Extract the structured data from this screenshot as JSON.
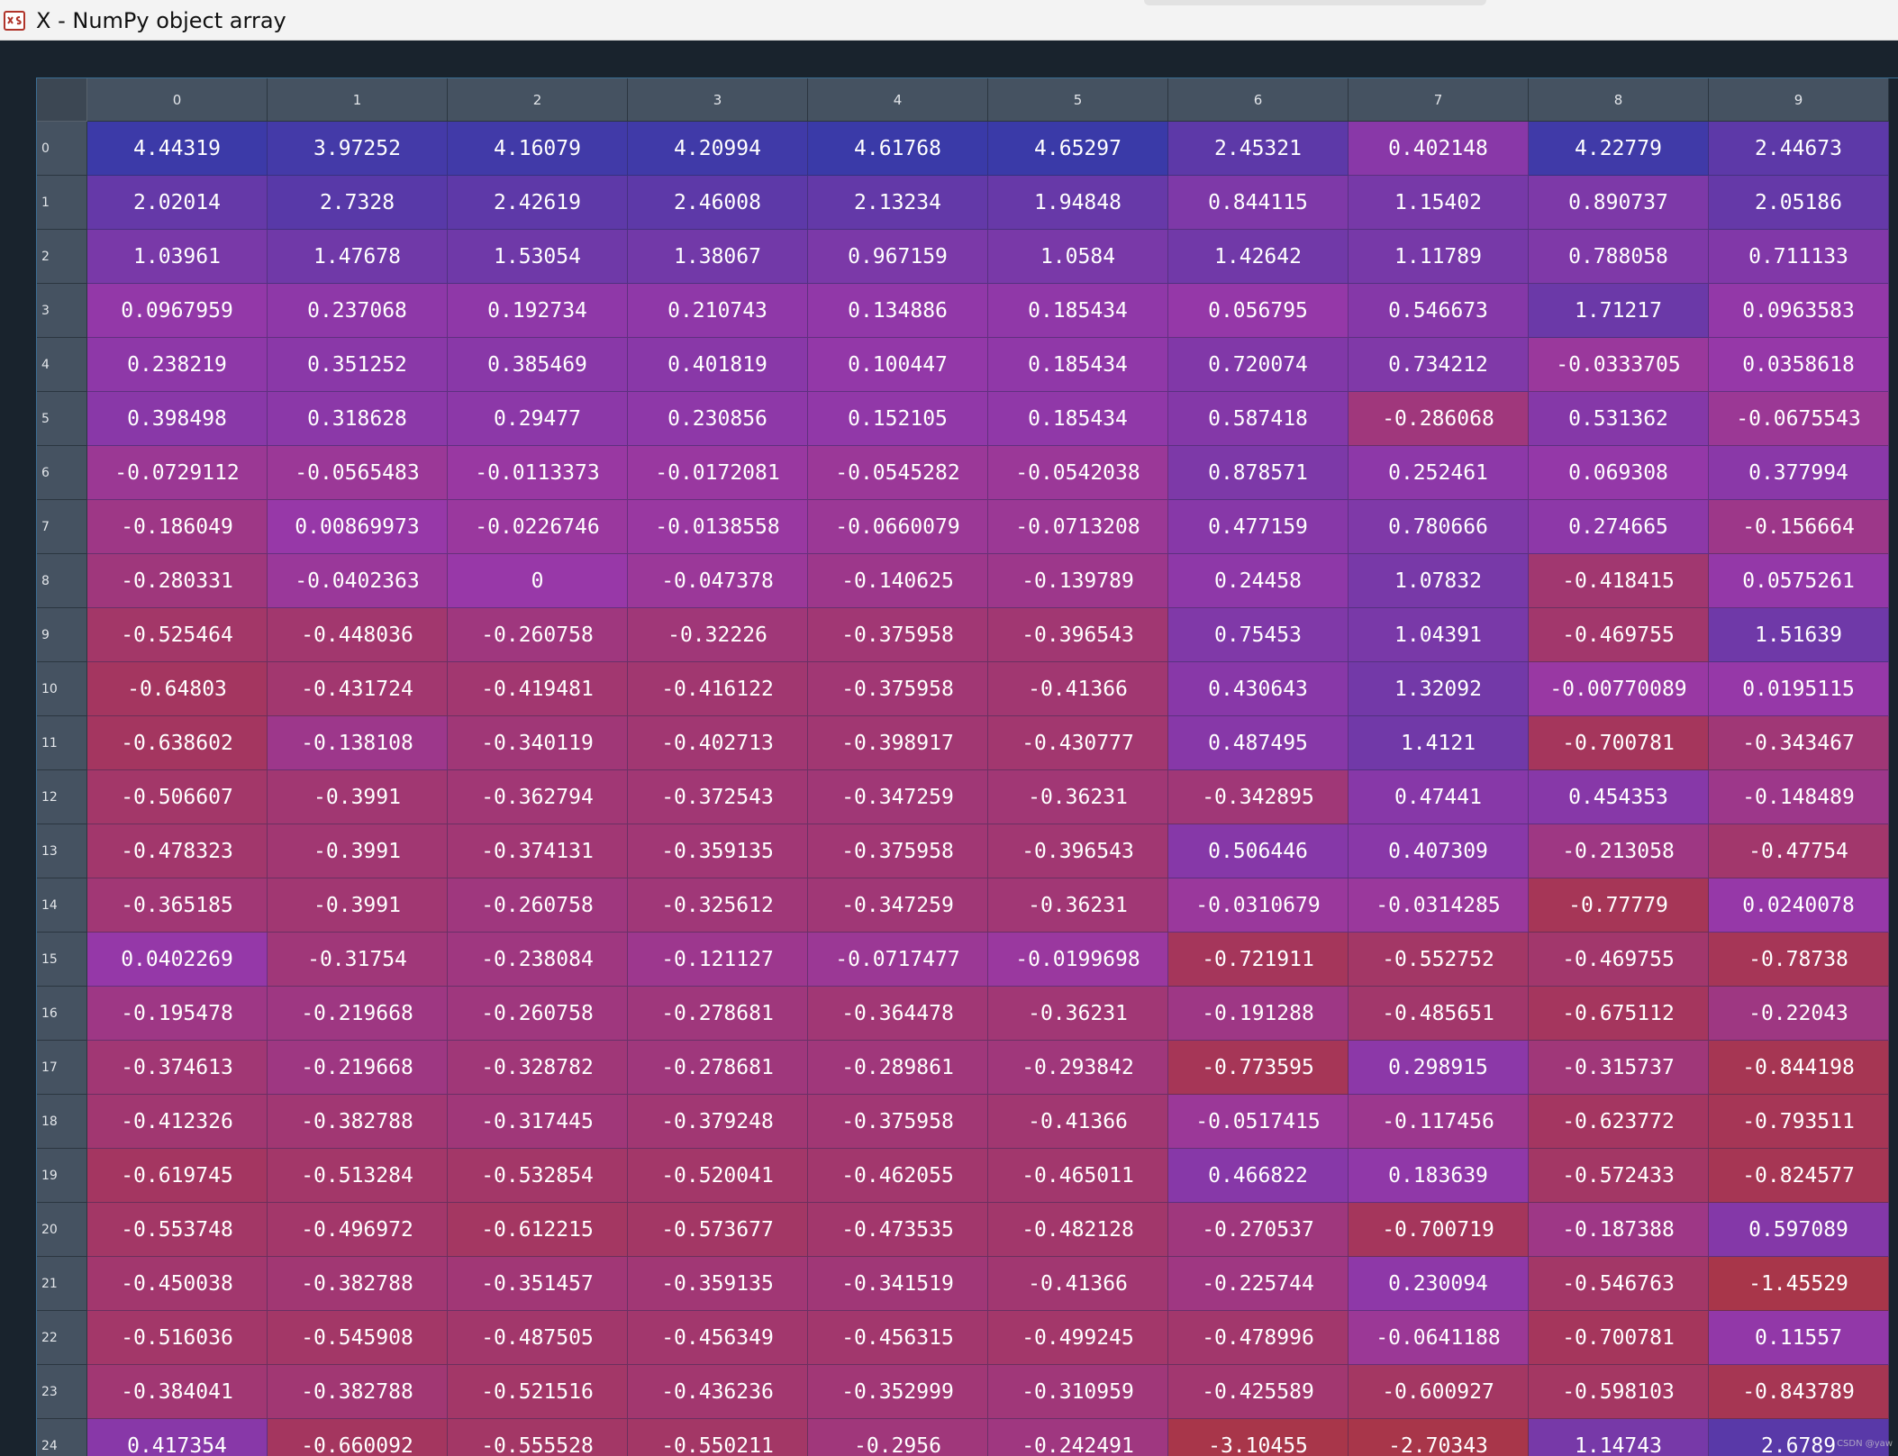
{
  "window": {
    "title": "X - NumPy object array",
    "icon": "spyder-variable-explorer-icon"
  },
  "table": {
    "columns": [
      "0",
      "1",
      "2",
      "3",
      "4",
      "5",
      "6",
      "7",
      "8",
      "9"
    ],
    "rows": [
      {
        "label": "0",
        "values": [
          "4.44319",
          "3.97252",
          "4.16079",
          "4.20994",
          "4.61768",
          "4.65297",
          "2.45321",
          "0.402148",
          "4.22779",
          "2.44673"
        ]
      },
      {
        "label": "1",
        "values": [
          "2.02014",
          "2.7328",
          "2.42619",
          "2.46008",
          "2.13234",
          "1.94848",
          "0.844115",
          "1.15402",
          "0.890737",
          "2.05186"
        ]
      },
      {
        "label": "2",
        "values": [
          "1.03961",
          "1.47678",
          "1.53054",
          "1.38067",
          "0.967159",
          "1.0584",
          "1.42642",
          "1.11789",
          "0.788058",
          "0.711133"
        ]
      },
      {
        "label": "3",
        "values": [
          "0.0967959",
          "0.237068",
          "0.192734",
          "0.210743",
          "0.134886",
          "0.185434",
          "0.056795",
          "0.546673",
          "1.71217",
          "0.0963583"
        ]
      },
      {
        "label": "4",
        "values": [
          "0.238219",
          "0.351252",
          "0.385469",
          "0.401819",
          "0.100447",
          "0.185434",
          "0.720074",
          "0.734212",
          "-0.0333705",
          "0.0358618"
        ]
      },
      {
        "label": "5",
        "values": [
          "0.398498",
          "0.318628",
          "0.29477",
          "0.230856",
          "0.152105",
          "0.185434",
          "0.587418",
          "-0.286068",
          "0.531362",
          "-0.0675543"
        ]
      },
      {
        "label": "6",
        "values": [
          "-0.0729112",
          "-0.0565483",
          "-0.0113373",
          "-0.0172081",
          "-0.0545282",
          "-0.0542038",
          "0.878571",
          "0.252461",
          "0.069308",
          "0.377994"
        ]
      },
      {
        "label": "7",
        "values": [
          "-0.186049",
          "0.00869973",
          "-0.0226746",
          "-0.0138558",
          "-0.0660079",
          "-0.0713208",
          "0.477159",
          "0.780666",
          "0.274665",
          "-0.156664"
        ]
      },
      {
        "label": "8",
        "values": [
          "-0.280331",
          "-0.0402363",
          "0",
          "-0.047378",
          "-0.140625",
          "-0.139789",
          "0.24458",
          "1.07832",
          "-0.418415",
          "0.0575261"
        ]
      },
      {
        "label": "9",
        "values": [
          "-0.525464",
          "-0.448036",
          "-0.260758",
          "-0.32226",
          "-0.375958",
          "-0.396543",
          "0.75453",
          "1.04391",
          "-0.469755",
          "1.51639"
        ]
      },
      {
        "label": "10",
        "values": [
          "-0.64803",
          "-0.431724",
          "-0.419481",
          "-0.416122",
          "-0.375958",
          "-0.41366",
          "0.430643",
          "1.32092",
          "-0.00770089",
          "0.0195115"
        ]
      },
      {
        "label": "11",
        "values": [
          "-0.638602",
          "-0.138108",
          "-0.340119",
          "-0.402713",
          "-0.398917",
          "-0.430777",
          "0.487495",
          "1.4121",
          "-0.700781",
          "-0.343467"
        ]
      },
      {
        "label": "12",
        "values": [
          "-0.506607",
          "-0.3991",
          "-0.362794",
          "-0.372543",
          "-0.347259",
          "-0.36231",
          "-0.342895",
          "0.47441",
          "0.454353",
          "-0.148489"
        ]
      },
      {
        "label": "13",
        "values": [
          "-0.478323",
          "-0.3991",
          "-0.374131",
          "-0.359135",
          "-0.375958",
          "-0.396543",
          "0.506446",
          "0.407309",
          "-0.213058",
          "-0.47754"
        ]
      },
      {
        "label": "14",
        "values": [
          "-0.365185",
          "-0.3991",
          "-0.260758",
          "-0.325612",
          "-0.347259",
          "-0.36231",
          "-0.0310679",
          "-0.0314285",
          "-0.77779",
          "0.0240078"
        ]
      },
      {
        "label": "15",
        "values": [
          "0.0402269",
          "-0.31754",
          "-0.238084",
          "-0.121127",
          "-0.0717477",
          "-0.0199698",
          "-0.721911",
          "-0.552752",
          "-0.469755",
          "-0.78738"
        ]
      },
      {
        "label": "16",
        "values": [
          "-0.195478",
          "-0.219668",
          "-0.260758",
          "-0.278681",
          "-0.364478",
          "-0.36231",
          "-0.191288",
          "-0.485651",
          "-0.675112",
          "-0.22043"
        ]
      },
      {
        "label": "17",
        "values": [
          "-0.374613",
          "-0.219668",
          "-0.328782",
          "-0.278681",
          "-0.289861",
          "-0.293842",
          "-0.773595",
          "0.298915",
          "-0.315737",
          "-0.844198"
        ]
      },
      {
        "label": "18",
        "values": [
          "-0.412326",
          "-0.382788",
          "-0.317445",
          "-0.379248",
          "-0.375958",
          "-0.41366",
          "-0.0517415",
          "-0.117456",
          "-0.623772",
          "-0.793511"
        ]
      },
      {
        "label": "19",
        "values": [
          "-0.619745",
          "-0.513284",
          "-0.532854",
          "-0.520041",
          "-0.462055",
          "-0.465011",
          "0.466822",
          "0.183639",
          "-0.572433",
          "-0.824577"
        ]
      },
      {
        "label": "20",
        "values": [
          "-0.553748",
          "-0.496972",
          "-0.612215",
          "-0.573677",
          "-0.473535",
          "-0.482128",
          "-0.270537",
          "-0.700719",
          "-0.187388",
          "0.597089"
        ]
      },
      {
        "label": "21",
        "values": [
          "-0.450038",
          "-0.382788",
          "-0.351457",
          "-0.359135",
          "-0.341519",
          "-0.41366",
          "-0.225744",
          "0.230094",
          "-0.546763",
          "-1.45529"
        ]
      },
      {
        "label": "22",
        "values": [
          "-0.516036",
          "-0.545908",
          "-0.487505",
          "-0.456349",
          "-0.456315",
          "-0.499245",
          "-0.478996",
          "-0.0641188",
          "-0.700781",
          "0.11557"
        ]
      },
      {
        "label": "23",
        "values": [
          "-0.384041",
          "-0.382788",
          "-0.521516",
          "-0.436236",
          "-0.352999",
          "-0.310959",
          "-0.425589",
          "-0.600927",
          "-0.598103",
          "-0.843789"
        ]
      },
      {
        "label": "24",
        "values": [
          "0.417354",
          "-0.660092",
          "-0.555528",
          "-0.550211",
          "-0.2956",
          "-0.242491",
          "-3.10455",
          "-2.70343",
          "1.14743",
          "2.6789"
        ]
      }
    ]
  },
  "colors": {
    "low": "#a8364a",
    "mid": "#9838a8",
    "high": "#3a3aa8",
    "header": "#455261",
    "background": "#19232d"
  },
  "watermark": "CSDN @yaw"
}
